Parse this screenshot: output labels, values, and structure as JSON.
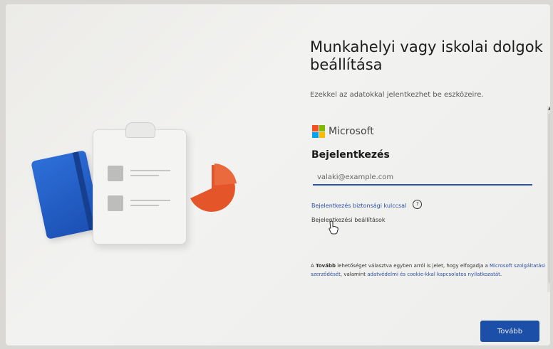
{
  "header": {
    "title": "Munkahelyi vagy iskolai dolgok beállítása",
    "subtitle": "Ezekkel az adatokkal jelentkezhet be eszközeire."
  },
  "brand": {
    "name": "Microsoft",
    "logo_colors": [
      "#f25022",
      "#7fba00",
      "#00a4ef",
      "#ffb900"
    ]
  },
  "signin": {
    "heading": "Bejelentkezés",
    "email_placeholder": "valaki@example.com",
    "security_key_link": "Bejelentkezés biztonsági kulccsal",
    "help_glyph": "?",
    "options_link": "Bejelentkezési beállítások"
  },
  "legal": {
    "prefix": "A ",
    "next_word": "Tovább",
    "middle": " lehetőséget választva egyben arról is jelet, hogy elfogadja a ",
    "microsoft_link": "Microsoft",
    "agreement_link": "szolgáltatási szerződését",
    "middle2": ", valamint ",
    "privacy_link": "adatvédelmi és cookie-kkal kapcsolatos nyilatkozatát",
    "suffix": "."
  },
  "actions": {
    "next_label": "Tovább"
  },
  "colors": {
    "accent": "#1c4fa8",
    "notebook": "#2d6fd8",
    "pie": "#e4562a"
  }
}
